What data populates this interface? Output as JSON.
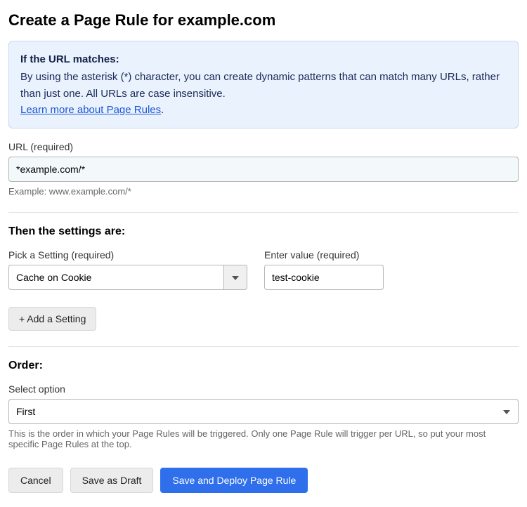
{
  "title": "Create a Page Rule for example.com",
  "info": {
    "heading": "If the URL matches:",
    "body_a": "By using the asterisk (*) character, you can create dynamic patterns that can match many URLs, rather than just one. All URLs are case insensitive.",
    "link_text": "Learn more about Page Rules",
    "link_suffix": "."
  },
  "url_field": {
    "label": "URL (required)",
    "value": "*example.com/*",
    "example": "Example: www.example.com/*"
  },
  "settings": {
    "heading": "Then the settings are:",
    "pick_label": "Pick a Setting (required)",
    "pick_value": "Cache on Cookie",
    "value_label": "Enter value (required)",
    "value_value": "test-cookie",
    "add_label": "+ Add a Setting"
  },
  "order": {
    "heading": "Order:",
    "select_label": "Select option",
    "value": "First",
    "help": "This is the order in which your Page Rules will be triggered. Only one Page Rule will trigger per URL, so put your most specific Page Rules at the top."
  },
  "footer": {
    "cancel": "Cancel",
    "draft": "Save as Draft",
    "deploy": "Save and Deploy Page Rule"
  }
}
